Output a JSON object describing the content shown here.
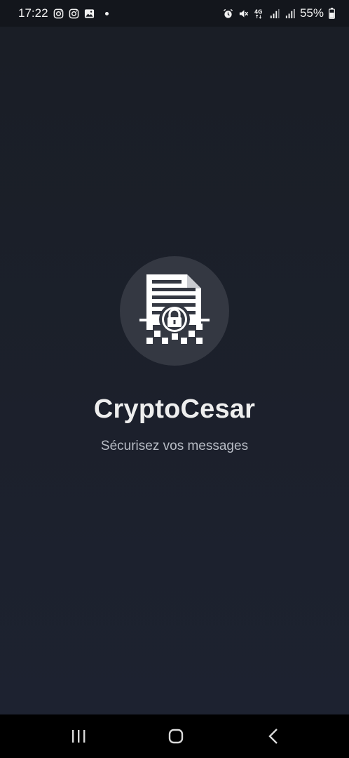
{
  "status_bar": {
    "time": "17:22",
    "battery": "55%",
    "left_icons": [
      "instagram-icon",
      "instagram-icon",
      "gallery-icon",
      "notification-dot"
    ],
    "right_icons": [
      "alarm-icon",
      "mute-icon",
      "4g-icon",
      "signal-icon",
      "signal-icon",
      "battery-icon"
    ]
  },
  "app": {
    "name": "CryptoCesar",
    "tagline": "Sécurisez vos messages",
    "logo_icon": "encrypted-document-lock-icon"
  },
  "nav_bar": {
    "buttons": [
      "recent-apps",
      "home",
      "back"
    ]
  },
  "colors": {
    "background": "#1b1f28",
    "logo_circle": "#343842",
    "title": "#eeeeee",
    "subtitle": "#b8bcc5"
  }
}
